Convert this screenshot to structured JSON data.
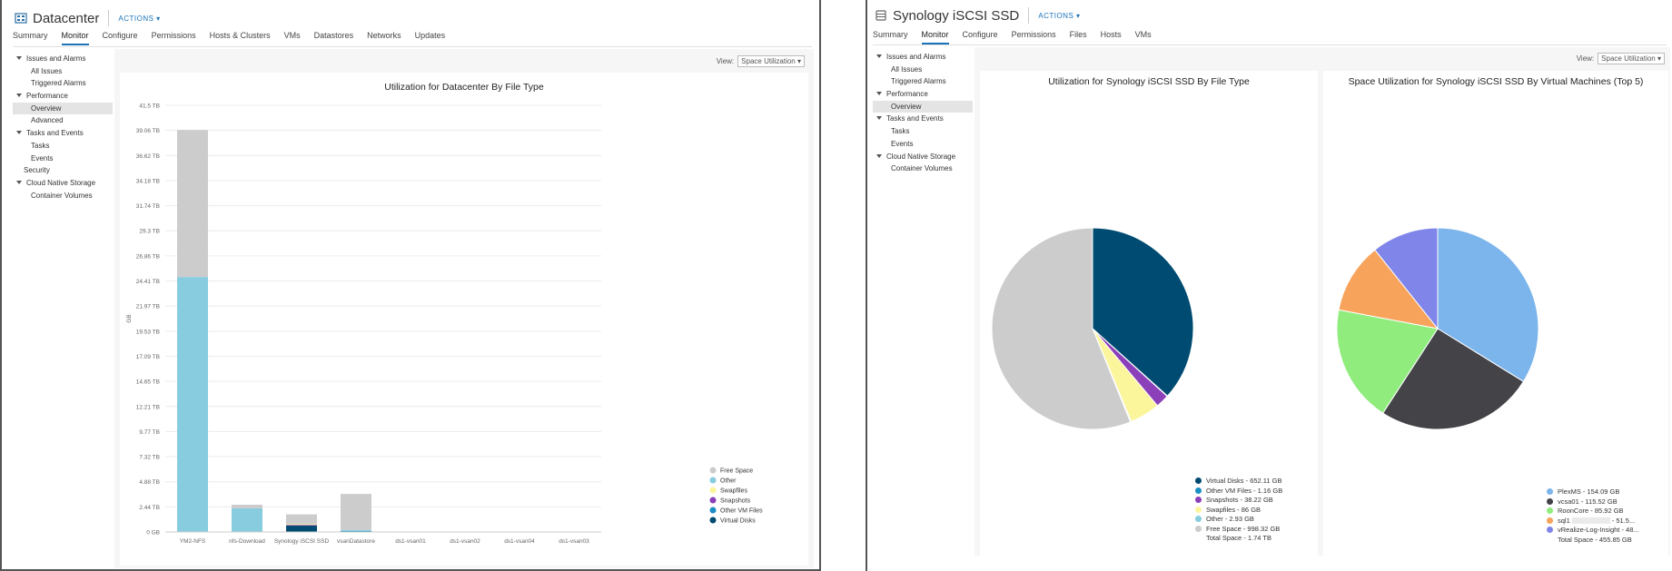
{
  "left": {
    "title": "Datacenter",
    "actions": "ACTIONS",
    "tabs": [
      "Summary",
      "Monitor",
      "Configure",
      "Permissions",
      "Hosts & Clusters",
      "VMs",
      "Datastores",
      "Networks",
      "Updates"
    ],
    "active_tab": "Monitor",
    "sidebar": [
      {
        "label": "Issues and Alarms",
        "level": 0,
        "caret": true
      },
      {
        "label": "All Issues",
        "level": 1
      },
      {
        "label": "Triggered Alarms",
        "level": 1
      },
      {
        "label": "Performance",
        "level": 0,
        "caret": true
      },
      {
        "label": "Overview",
        "level": 1,
        "selected": true
      },
      {
        "label": "Advanced",
        "level": 1
      },
      {
        "label": "Tasks and Events",
        "level": 0,
        "caret": true
      },
      {
        "label": "Tasks",
        "level": 1
      },
      {
        "label": "Events",
        "level": 1
      },
      {
        "label": "Security",
        "level": 0,
        "caret": false
      },
      {
        "label": "Cloud Native Storage",
        "level": 0,
        "caret": true
      },
      {
        "label": "Container Volumes",
        "level": 1
      }
    ],
    "view_label": "View:",
    "view_value": "Space Utilization"
  },
  "right": {
    "title": "Synology iSCSI SSD",
    "actions": "ACTIONS",
    "tabs": [
      "Summary",
      "Monitor",
      "Configure",
      "Permissions",
      "Files",
      "Hosts",
      "VMs"
    ],
    "active_tab": "Monitor",
    "sidebar": [
      {
        "label": "Issues and Alarms",
        "level": 0,
        "caret": true
      },
      {
        "label": "All Issues",
        "level": 1
      },
      {
        "label": "Triggered Alarms",
        "level": 1
      },
      {
        "label": "Performance",
        "level": 0,
        "caret": true
      },
      {
        "label": "Overview",
        "level": 1,
        "selected": true
      },
      {
        "label": "Tasks and Events",
        "level": 0,
        "caret": true
      },
      {
        "label": "Tasks",
        "level": 1
      },
      {
        "label": "Events",
        "level": 1
      },
      {
        "label": "Cloud Native Storage",
        "level": 0,
        "caret": true
      },
      {
        "label": "Container Volumes",
        "level": 1
      }
    ],
    "view_label": "View:",
    "view_value": "Space Utilization"
  },
  "colors": {
    "free_space": "#cccccc",
    "other": "#88cce0",
    "swapfiles": "#fbf59b",
    "snapshots": "#8b3fb8",
    "other_vm_files": "#1b8fc4",
    "virtual_disks": "#004b71",
    "plexms": "#7cb4ec",
    "vcsa01": "#434348",
    "roomcore": "#90ed7d",
    "sql1": "#f7a35c",
    "vrealize": "#8085e9",
    "accent": "#1a73b8"
  },
  "chart_data": [
    {
      "type": "bar",
      "stacked": true,
      "title": "Utilization for Datacenter By File Type",
      "ylabel": "GB",
      "ylim": [
        0,
        41.5
      ],
      "yunit": "TB",
      "y_ticks": [
        "0 GB",
        "2.44 TB",
        "4.88 TB",
        "7.32 TB",
        "9.77 TB",
        "12.21 TB",
        "14.65 TB",
        "17.09 TB",
        "19.53 TB",
        "21.97 TB",
        "24.41 TB",
        "26.86 TB",
        "29.3 TB",
        "31.74 TB",
        "34.18 TB",
        "36.62 TB",
        "39.06 TB",
        "41.5 TB"
      ],
      "categories": [
        "YM2-NFS",
        "nfs-Download",
        "Synology iSCSI SSD",
        "vsanDatastore",
        "ds1-vsan01",
        "ds1-vsan02",
        "ds1-vsan04",
        "ds1-vsan03"
      ],
      "series": [
        {
          "name": "Virtual Disks",
          "color": "#004b71",
          "values": [
            0,
            0,
            0.64,
            0,
            0,
            0,
            0,
            0
          ]
        },
        {
          "name": "Other VM Files",
          "color": "#1b8fc4",
          "values": [
            0,
            0,
            0,
            0.1,
            0,
            0,
            0,
            0
          ]
        },
        {
          "name": "Snapshots",
          "color": "#8b3fb8",
          "values": [
            0,
            0,
            0.04,
            0,
            0,
            0,
            0,
            0
          ]
        },
        {
          "name": "Swapfiles",
          "color": "#fbf59b",
          "values": [
            0,
            0,
            0.08,
            0,
            0,
            0,
            0,
            0
          ]
        },
        {
          "name": "Other",
          "color": "#88cce0",
          "values": [
            24.8,
            2.3,
            0,
            0.1,
            0,
            0,
            0,
            0
          ]
        },
        {
          "name": "Free Space",
          "color": "#cccccc",
          "values": [
            14.3,
            0.35,
            0.95,
            3.5,
            0,
            0,
            0,
            0
          ]
        }
      ],
      "legend_order": [
        "Free Space",
        "Other",
        "Swapfiles",
        "Snapshots",
        "Other VM Files",
        "Virtual Disks"
      ],
      "legend": "right-bottom",
      "grid": true
    },
    {
      "type": "pie",
      "title": "Utilization for Synology iSCSI SSD By File Type",
      "slices": [
        {
          "name": "Virtual Disks",
          "label": "Virtual Disks - 652.11 GB",
          "value": 652.11,
          "color": "#004b71"
        },
        {
          "name": "Other VM Files",
          "label": "Other VM Files - 1.16 GB",
          "value": 1.16,
          "color": "#1b8fc4"
        },
        {
          "name": "Snapshots",
          "label": "Snapshots - 38.22 GB",
          "value": 38.22,
          "color": "#8b3fb8"
        },
        {
          "name": "Swapfiles",
          "label": "Swapfiles - 86 GB",
          "value": 86,
          "color": "#fbf59b"
        },
        {
          "name": "Other",
          "label": "Other - 2.93 GB",
          "value": 2.93,
          "color": "#88cce0"
        },
        {
          "name": "Free Space",
          "label": "Free Space - 998.32 GB",
          "value": 998.32,
          "color": "#cccccc"
        }
      ],
      "total": "Total Space - 1.74 TB",
      "legend": "bottom-right"
    },
    {
      "type": "pie",
      "title": "Space Utilization for Synology iSCSI SSD By Virtual Machines (Top 5)",
      "slices": [
        {
          "name": "PlexMS",
          "label": "PlexMS - 154.09 GB",
          "value": 154.09,
          "color": "#7cb4ec"
        },
        {
          "name": "vcsa01",
          "label": "vcsa01 - 115.52 GB",
          "value": 115.52,
          "color": "#434348"
        },
        {
          "name": "RoonCore",
          "label": "RoonCore - 85.92 GB",
          "value": 85.92,
          "color": "#90ed7d"
        },
        {
          "name": "sql1",
          "label_prefix": "sql1",
          "label_suffix": "- 51.5...",
          "value": 51.5,
          "color": "#f7a35c"
        },
        {
          "name": "vRealize-Log-Insight",
          "label": "vRealize-Log-Insight - 48...",
          "value": 48.8,
          "color": "#8085e9"
        }
      ],
      "total": "Total Space - 455.85 GB",
      "legend": "bottom-right"
    }
  ]
}
